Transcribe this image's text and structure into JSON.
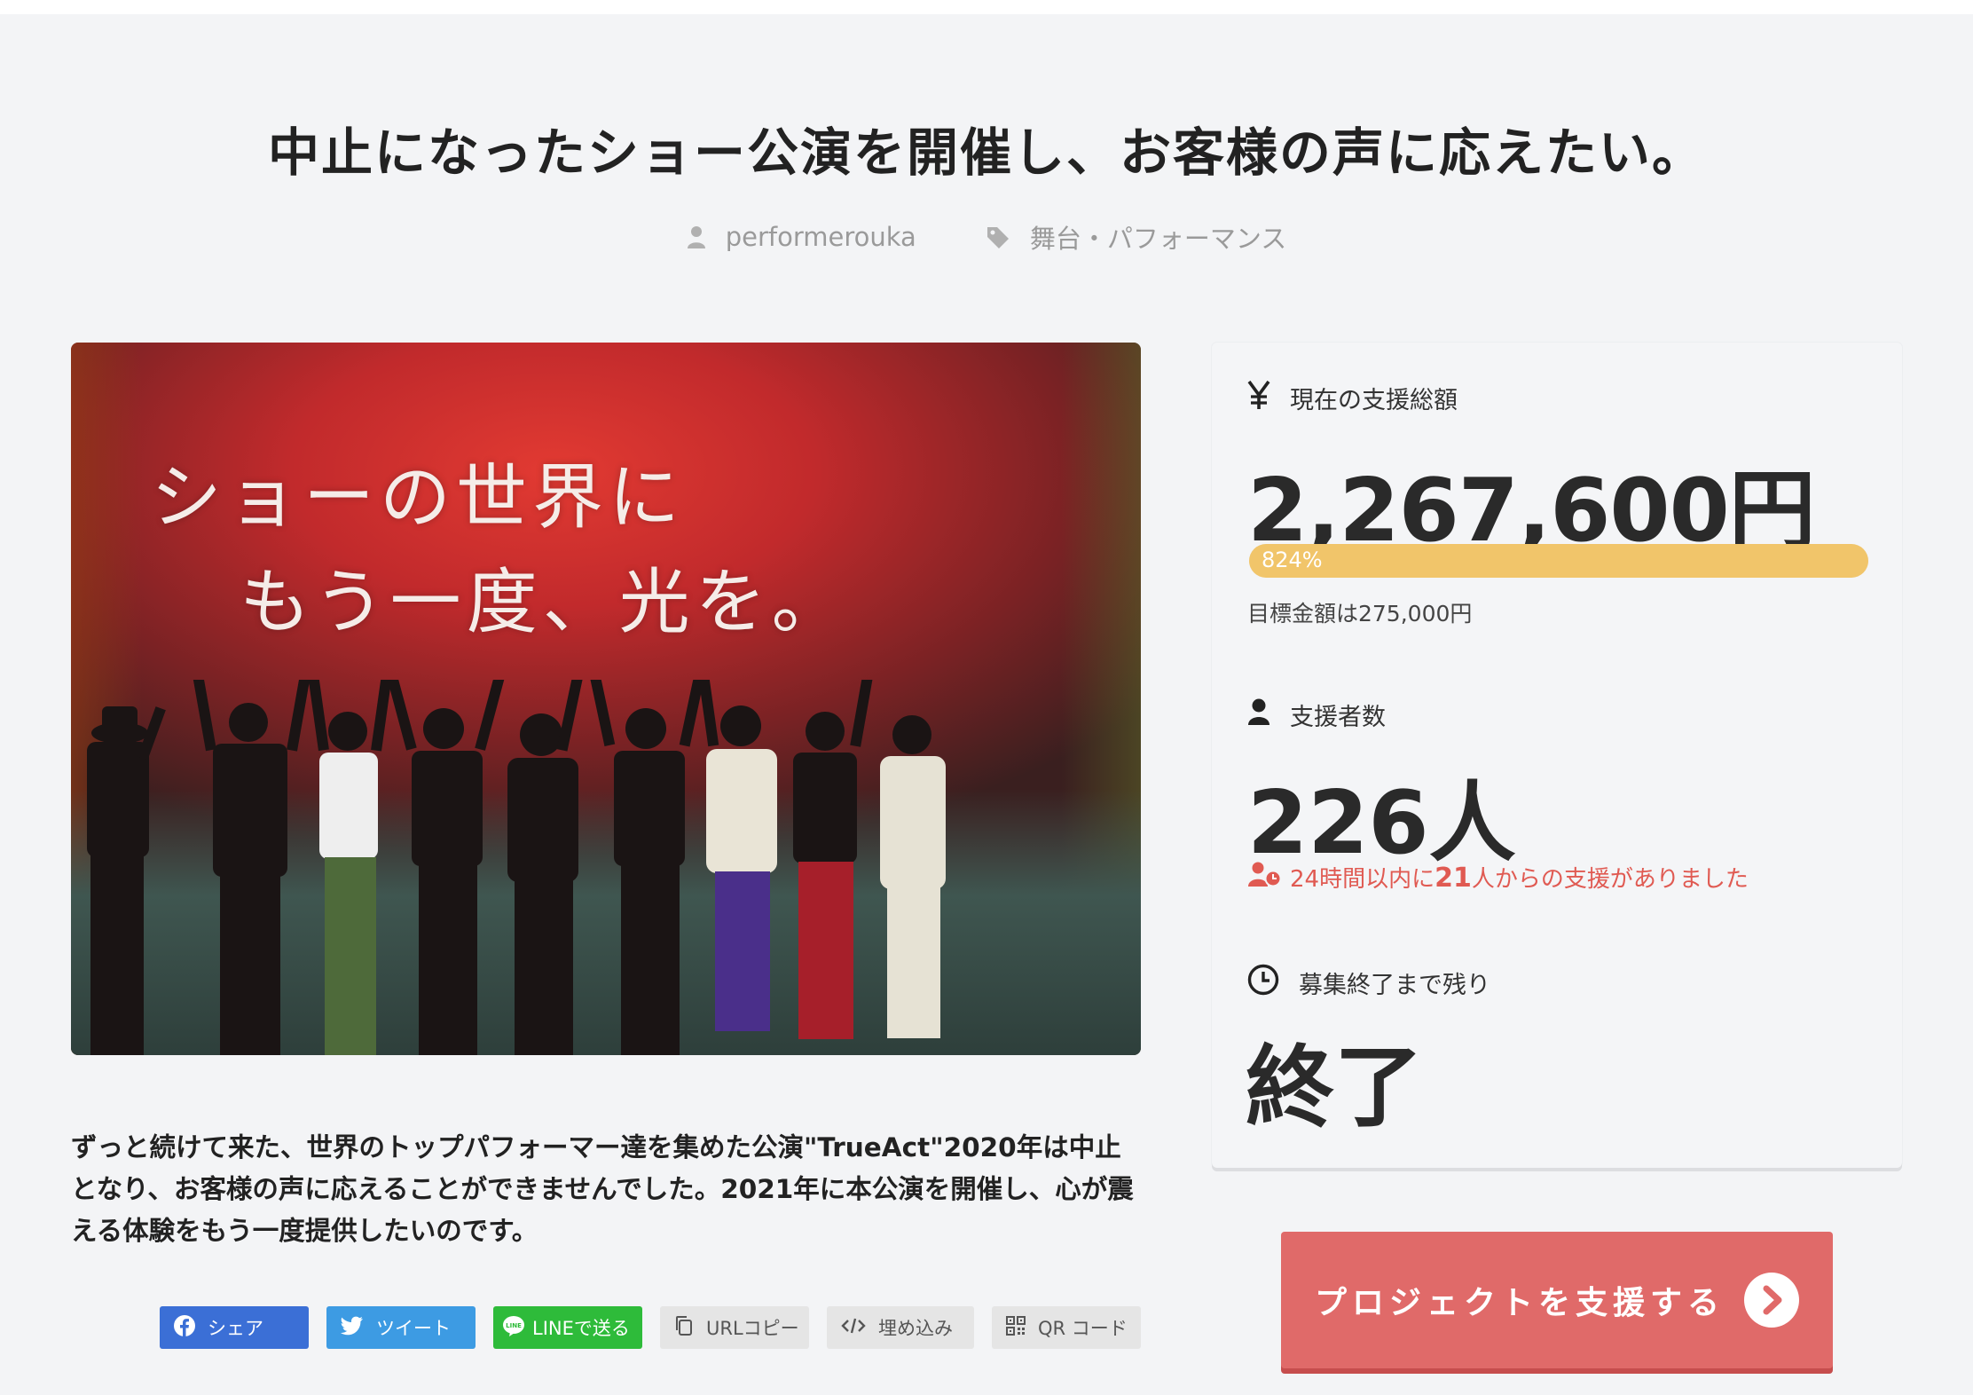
{
  "project": {
    "title": "中止になったショー公演を開催し、お客様の声に応えたい。",
    "author": "performerouka",
    "category": "舞台・パフォーマンス"
  },
  "hero": {
    "line1": "ショーの世界に",
    "line2": "もう一度、光を。"
  },
  "description": "ずっと続けて来た、世界のトップパフォーマー達を集めた公演\"TrueAct\"2020年は中止となり、お客様の声に応えることができませんでした。2021年に本公演を開催し、心が震える体験をもう一度提供したいのです。",
  "share": {
    "facebook": "シェア",
    "twitter": "ツイート",
    "line": "LINEで送る",
    "url_copy": "URLコピー",
    "embed": "埋め込み",
    "qr": "QR コード"
  },
  "stats": {
    "total_label": "現在の支援総額",
    "total_amount": "2,267,600円",
    "progress_text": "824%",
    "progress_fraction": 1.0,
    "goal_text": "目標金額は275,000円",
    "backers_label": "支援者数",
    "backers_count": "226人",
    "recent_prefix": "24時間以内に",
    "recent_count": "21",
    "recent_suffix": "人からの支援がありました",
    "remaining_label": "募集終了まで残り",
    "remaining_value": "終了"
  },
  "cta": {
    "support_label": "プロジェクトを支援する"
  },
  "colors": {
    "background": "#f3f4f6",
    "progress": "#f1c56a",
    "accent_red": "#e05a52",
    "cta": "#e06a69",
    "facebook": "#3b6fd6",
    "twitter": "#3d9be3",
    "line": "#2ebb3a"
  },
  "icons": {
    "author": "user-icon",
    "category": "tag-icon",
    "total": "yen-icon",
    "backers": "user-icon",
    "recent": "user-clock-icon",
    "remaining": "clock-icon",
    "cta": "chevron-right-circle-icon"
  }
}
